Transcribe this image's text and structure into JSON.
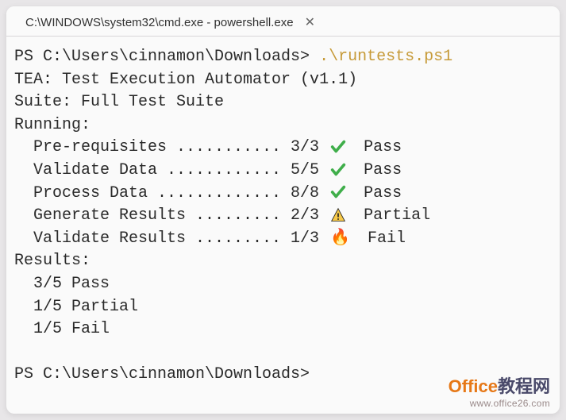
{
  "tab": {
    "title": "C:\\WINDOWS\\system32\\cmd.exe - powershell.exe"
  },
  "prompt1": {
    "ps": "PS C:\\Users\\cinnamon\\Downloads> ",
    "command": ".\\runtests.ps1"
  },
  "header": {
    "tea": "TEA: Test Execution Automator (v1.1)",
    "suite": "Suite: Full Test Suite",
    "running": "Running:"
  },
  "tests": [
    {
      "name": "Pre-requisites ........... 3/3",
      "icon": "pass",
      "status": "Pass"
    },
    {
      "name": "Validate Data ............ 5/5",
      "icon": "pass",
      "status": "Pass"
    },
    {
      "name": "Process Data ............. 8/8",
      "icon": "pass",
      "status": "Pass"
    },
    {
      "name": "Generate Results ......... 2/3",
      "icon": "warn",
      "status": "Partial"
    },
    {
      "name": "Validate Results ......... 1/3",
      "icon": "fail",
      "status": "Fail"
    }
  ],
  "results": {
    "label": "Results:",
    "lines": [
      "3/5 Pass",
      "1/5 Partial",
      "1/5 Fail"
    ]
  },
  "prompt2": {
    "ps": "PS C:\\Users\\cinnamon\\Downloads> "
  },
  "watermark": {
    "brand_left": "Office",
    "brand_right": "教程网",
    "url": "www.office26.com"
  }
}
